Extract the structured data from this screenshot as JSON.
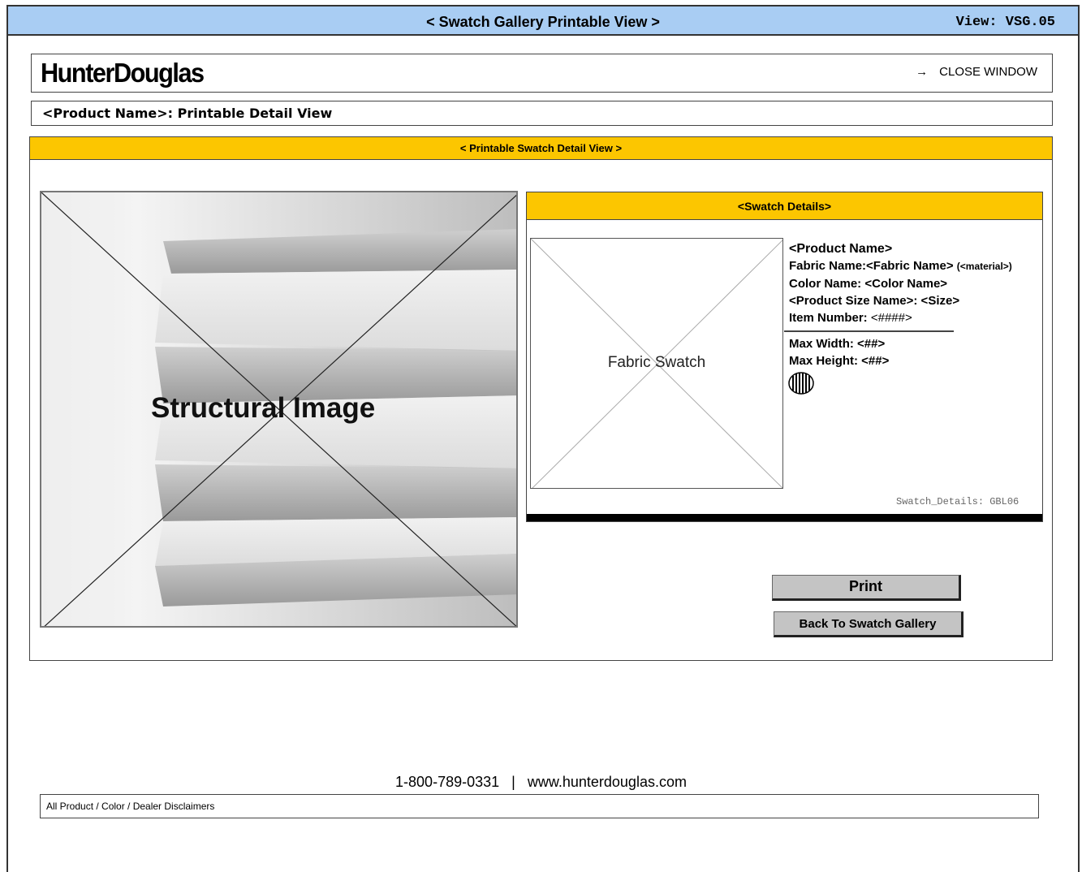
{
  "titlebar": {
    "title": "< Swatch Gallery Printable View >",
    "view_label": "View: VSG.05",
    "color": "#a9cdf3"
  },
  "header": {
    "logo": "HunterDouglas",
    "close_label": "CLOSE WINDOW",
    "close_icon": "arrow-right-icon"
  },
  "product_bar": {
    "title": "<Product Name>: Printable Detail View"
  },
  "detail": {
    "heading": "< Printable Swatch Detail View >",
    "accent_color": "#fcc600",
    "structural_image_label": "Structural Image"
  },
  "swatch": {
    "heading": "<Swatch Details>",
    "fabric_label": "Fabric Swatch",
    "product_name": "<Product Name>",
    "fabric_name_label": "Fabric Name:<Fabric Name>",
    "material": "(<material>)",
    "color_name": "Color Name: <Color Name>",
    "size": "<Product Size Name>: <Size>",
    "item_number_label": "Item Number:",
    "item_number_value": "<####>",
    "max_width": "Max Width:  <##>",
    "max_height": "Max Height:  <##>",
    "pattern_icon": "vertical-stripes-icon",
    "id": "Swatch_Details: GBL06"
  },
  "buttons": {
    "print": "Print",
    "back": "Back To Swatch Gallery"
  },
  "footer": {
    "phone": "1-800-789-0331",
    "separator": "|",
    "website": "www.hunterdouglas.com",
    "disclaimer": "All Product / Color /  Dealer Disclaimers"
  }
}
